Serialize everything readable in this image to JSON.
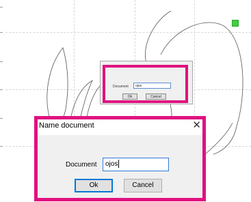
{
  "dialog": {
    "title": "Name document",
    "field_label": "Document",
    "field_value": "ojos",
    "ok_label": "Ok",
    "cancel_label": "Cancel",
    "close_icon": "close-icon",
    "close_glyph": "✕"
  },
  "mini_dialog": {
    "field_label": "Document",
    "field_value": "ojos",
    "ok_label": "Ok",
    "cancel_label": "Cancel"
  },
  "colors": {
    "highlight": "#e0117f",
    "handle": "#3fd13f",
    "input_focus": "#2f7bd9"
  }
}
